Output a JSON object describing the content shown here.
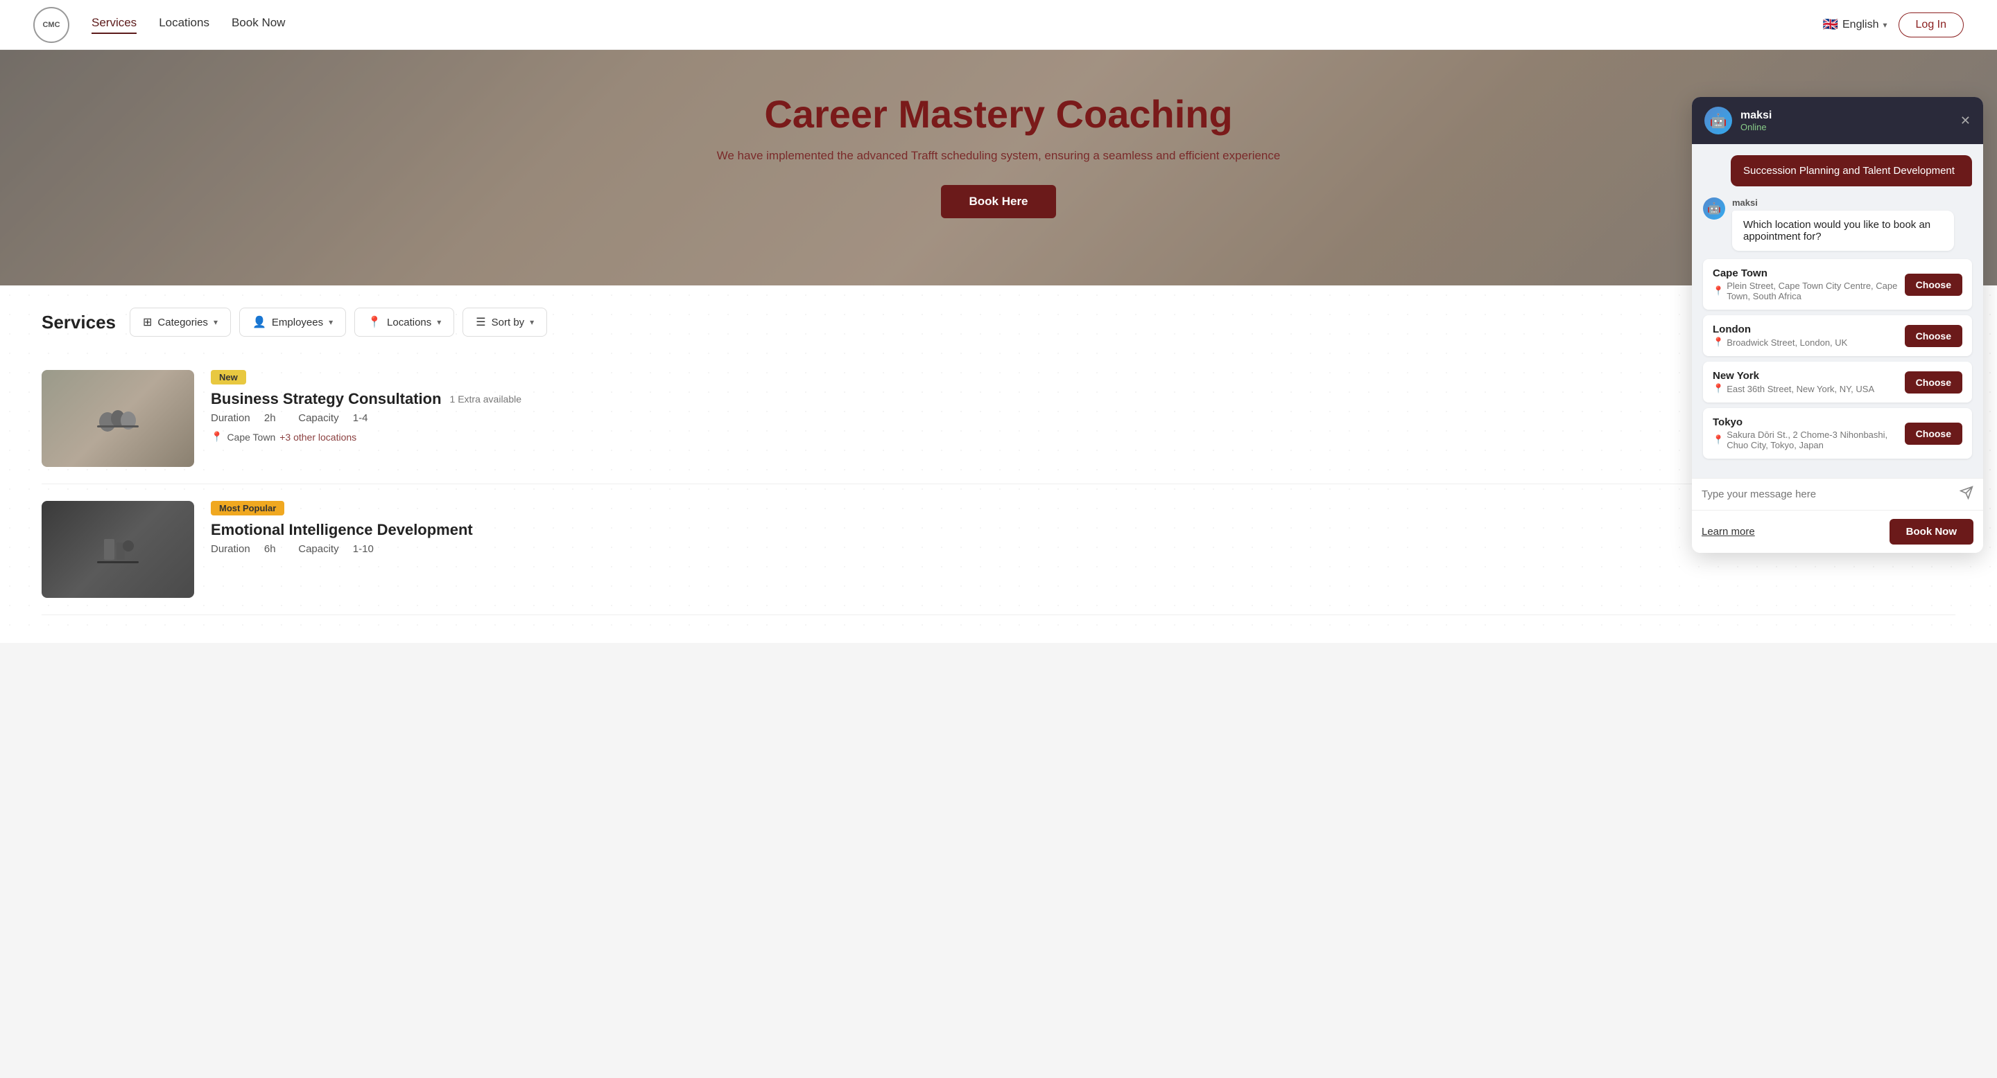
{
  "navbar": {
    "logo_text": "CMC",
    "links": [
      {
        "label": "Services",
        "active": true
      },
      {
        "label": "Locations",
        "active": false
      },
      {
        "label": "Book Now",
        "active": false
      }
    ],
    "lang": "English",
    "login_label": "Log In"
  },
  "hero": {
    "title": "Career Mastery Coaching",
    "subtitle": "We have implemented the advanced Trafft scheduling system, ensuring a seamless and efficient experience",
    "cta": "Book Here"
  },
  "services_section": {
    "title": "Services",
    "filters": [
      {
        "label": "Categories",
        "icon": "⊞"
      },
      {
        "label": "Employees",
        "icon": "👤"
      },
      {
        "label": "Locations",
        "icon": "📍"
      },
      {
        "label": "Sort by",
        "icon": "☰"
      }
    ],
    "cards": [
      {
        "badge": "New",
        "badge_type": "new",
        "name": "Business Strategy Consultation",
        "extra": "1 Extra available",
        "duration": "2h",
        "capacity": "1-4",
        "location": "Cape Town",
        "extra_locations": "+3 other locations"
      },
      {
        "badge": "Most Popular",
        "badge_type": "popular",
        "name": "Emotional Intelligence Development",
        "extra": "",
        "duration": "6h",
        "capacity": "1-10",
        "location": "",
        "extra_locations": ""
      }
    ]
  },
  "chat": {
    "agent_name": "maksi",
    "agent_status": "Online",
    "avatar_emoji": "🤖",
    "sent_message": "Succession Planning and Talent Development",
    "bot_name": "maksi",
    "bot_question": "Which location would you like to book an appointment for?",
    "locations": [
      {
        "name": "Cape Town",
        "address": "Plein Street, Cape Town City Centre, Cape Town, South Africa",
        "choose_label": "Choose"
      },
      {
        "name": "London",
        "address": "Broadwick Street, London, UK",
        "choose_label": "Choose"
      },
      {
        "name": "New York",
        "address": "East 36th Street, New York, NY, USA",
        "choose_label": "Choose"
      },
      {
        "name": "Tokyo",
        "address": "Sakura Dōri St., 2 Chome-3 Nihonbashi, Chuo City, Tokyo, Japan",
        "choose_label": "Choose"
      }
    ],
    "input_placeholder": "Type your message here",
    "learn_more": "Learn more",
    "book_now": "Book Now"
  }
}
